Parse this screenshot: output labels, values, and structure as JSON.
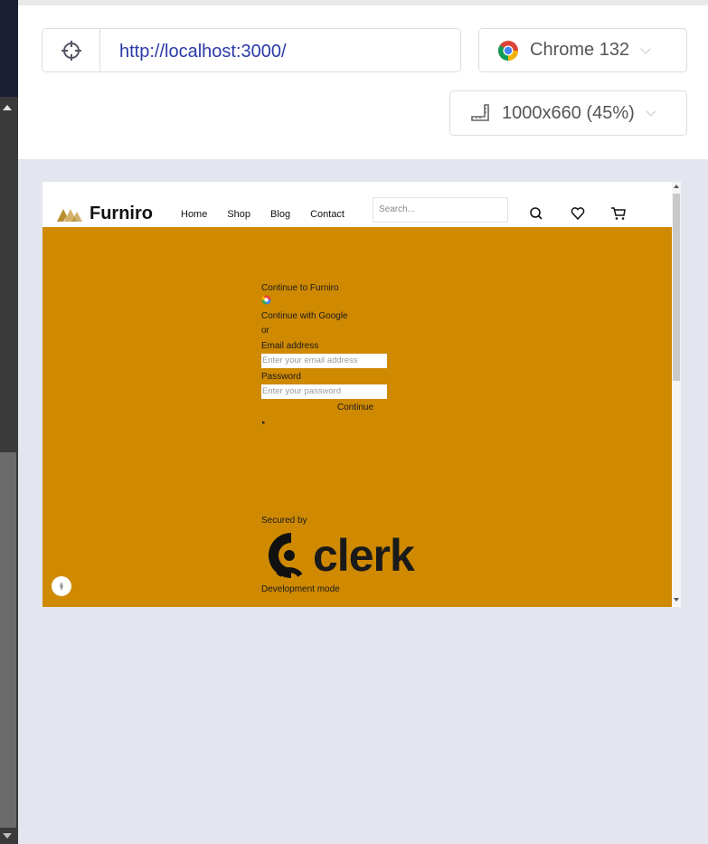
{
  "toolbar": {
    "url": "http://localhost:3000/",
    "browser": "Chrome 132",
    "viewport": "1000x660 (45%)"
  },
  "site": {
    "brand": "Furniro",
    "nav": [
      "Home",
      "Shop",
      "Blog",
      "Contact"
    ],
    "search_placeholder": "Search..."
  },
  "clerk": {
    "title": "Continue to Furniro",
    "google": "Continue with Google",
    "or": "or",
    "email_label": "Email address",
    "email_placeholder": "Enter your email address",
    "password_label": "Password",
    "password_placeholder": "Enter your password",
    "continue": "Continue",
    "secured_by": "Secured by",
    "clerk_logo": "clerk",
    "dev_mode": "Development mode"
  },
  "colors": {
    "hero_bg": "#cf8a02",
    "url_text": "#2a3aa8"
  }
}
